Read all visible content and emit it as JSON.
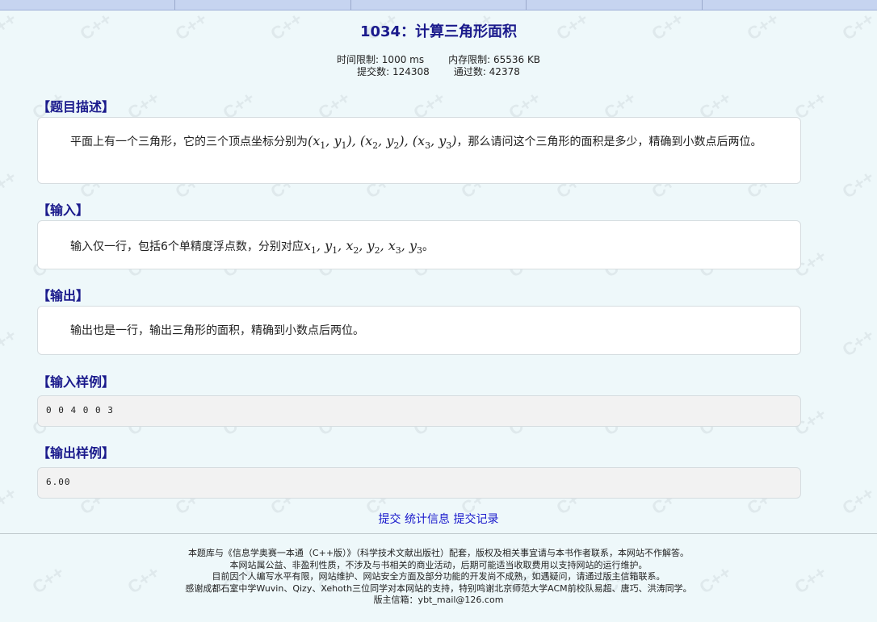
{
  "problem": {
    "title": "1034：计算三角形面积",
    "time_limit": "时间限制: 1000 ms",
    "memory_limit": "内存限制: 65536 KB",
    "submissions": "提交数: 124308",
    "accepted": "通过数: 42378"
  },
  "sections": {
    "description_head": "【题目描述】",
    "description_text_1": "平面上有一个三角形，它的三个顶点坐标分别为",
    "description_text_2": "，那么请问这个三角形的面积是多少，精确到小数点后两位。",
    "input_head": "【输入】",
    "input_text_1": "输入仅一行，包括6个单精度浮点数，分别对应",
    "input_text_2": "。",
    "output_head": "【输出】",
    "output_text": "输出也是一行，输出三角形的面积，精确到小数点后两位。",
    "sample_input_head": "【输入样例】",
    "sample_input": "0 0 4 0 0 3",
    "sample_output_head": "【输出样例】",
    "sample_output": "6.00"
  },
  "links": {
    "submit": "提交",
    "stats": "统计信息",
    "records": "提交记录"
  },
  "footer": {
    "line1": "本题库与《信息学奥赛一本通（C++版）》（科学技术文献出版社）配套，版权及相关事宜请与本书作者联系，本网站不作解答。",
    "line2": "本网站属公益、非盈利性质，不涉及与书相关的商业活动，后期可能适当收取费用以支持网站的运行维护。",
    "line3": "目前因个人编写水平有限，网站维护、网站安全方面及部分功能的开发尚不成熟，如遇疑问，请通过版主信箱联系。",
    "line4": "感谢成都石室中学Wuvin、Qizy、Xehoth三位同学对本网站的支持，特别鸣谢北京师范大学ACM前校队易超、唐巧、洪涛同学。",
    "line5": "版主信箱：ybt_mail@126.com"
  },
  "watermark": "C++"
}
